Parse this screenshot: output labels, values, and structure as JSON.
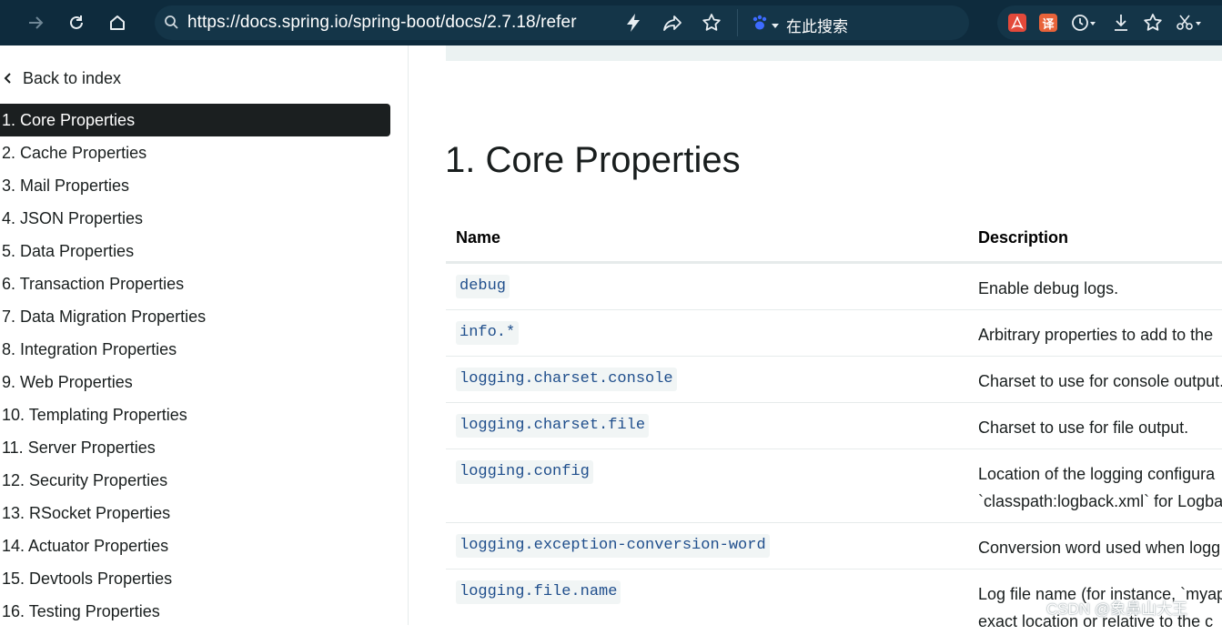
{
  "browser": {
    "url": "https://docs.spring.io/spring-boot/docs/2.7.18/refer",
    "search_label": "在此搜索",
    "ext_pdf_label": "",
    "ext_translate_label": "译",
    "colors": {
      "toolbar": "#0e2b3d",
      "pdf": "#e3493a",
      "translate": "#e8633a"
    },
    "icons": [
      "forward-icon",
      "reload-icon",
      "home-icon",
      "lightning-icon",
      "share-icon",
      "star-icon",
      "paw-icon",
      "pdf-icon",
      "translate-icon",
      "history-icon",
      "download-icon",
      "favorites-icon",
      "scissors-icon"
    ]
  },
  "sidebar": {
    "back_label": "Back to index",
    "items": [
      {
        "label": "1. Core Properties",
        "active": true
      },
      {
        "label": "2. Cache Properties"
      },
      {
        "label": "3. Mail Properties"
      },
      {
        "label": "4. JSON Properties"
      },
      {
        "label": "5. Data Properties"
      },
      {
        "label": "6. Transaction Properties"
      },
      {
        "label": "7. Data Migration Properties"
      },
      {
        "label": "8. Integration Properties"
      },
      {
        "label": "9. Web Properties"
      },
      {
        "label": "10. Templating Properties"
      },
      {
        "label": "11. Server Properties"
      },
      {
        "label": "12. Security Properties"
      },
      {
        "label": "13. RSocket Properties"
      },
      {
        "label": "14. Actuator Properties"
      },
      {
        "label": "15. Devtools Properties"
      },
      {
        "label": "16. Testing Properties"
      }
    ]
  },
  "main": {
    "title": "1. Core Properties",
    "table": {
      "headers": [
        "Name",
        "Description"
      ],
      "rows": [
        {
          "name": "debug",
          "desc": [
            "Enable debug logs."
          ]
        },
        {
          "name": "info.*",
          "desc": [
            "Arbitrary properties to add to the"
          ]
        },
        {
          "name": "logging.charset.console",
          "desc": [
            "Charset to use for console output."
          ]
        },
        {
          "name": "logging.charset.file",
          "desc": [
            "Charset to use for file output."
          ]
        },
        {
          "name": "logging.config",
          "desc": [
            "Location of the logging configura",
            "`classpath:logback.xml` for Logba"
          ]
        },
        {
          "name": "logging.exception-conversion-word",
          "desc": [
            "Conversion word used when logg"
          ]
        },
        {
          "name": "logging.file.name",
          "desc": [
            "Log file name (for instance, `myap",
            "exact location or relative to the c"
          ]
        }
      ]
    }
  },
  "watermark": "CSDN @象鼻山大王"
}
